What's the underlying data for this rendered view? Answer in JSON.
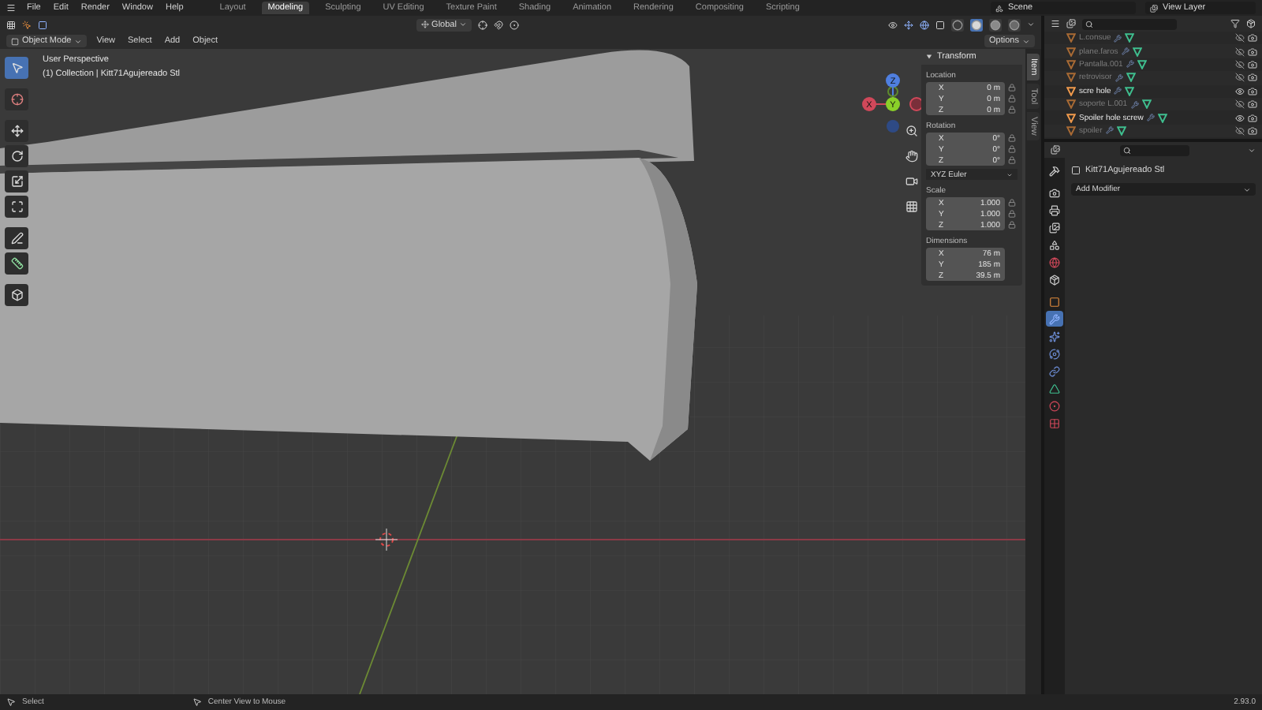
{
  "topbar": {
    "menus": [
      "File",
      "Edit",
      "Render",
      "Window",
      "Help"
    ],
    "workspaces": [
      {
        "label": "Layout",
        "selected": false
      },
      {
        "label": "Modeling",
        "selected": true
      },
      {
        "label": "Sculpting",
        "selected": false
      },
      {
        "label": "UV Editing",
        "selected": false
      },
      {
        "label": "Texture Paint",
        "selected": false
      },
      {
        "label": "Shading",
        "selected": false
      },
      {
        "label": "Animation",
        "selected": false
      },
      {
        "label": "Rendering",
        "selected": false
      },
      {
        "label": "Compositing",
        "selected": false
      },
      {
        "label": "Scripting",
        "selected": false
      }
    ],
    "scene": "Scene",
    "view_layer": "View Layer"
  },
  "viewport": {
    "header": {
      "orientation": "Global",
      "options": "Options",
      "mode": "Object Mode",
      "menus": [
        "View",
        "Select",
        "Add",
        "Object"
      ]
    },
    "shading": [
      {
        "kind": "wireframe",
        "selected": false
      },
      {
        "kind": "solid",
        "selected": true
      },
      {
        "kind": "material",
        "selected": false
      },
      {
        "kind": "rendered",
        "selected": false
      }
    ],
    "overlay_text": {
      "view": "User Perspective",
      "context": "(1) Collection | Kitt71Agujereado Stl"
    },
    "tools": [
      {
        "kind": "select",
        "selected": true
      },
      {
        "kind": "cursor",
        "selected": false
      },
      {
        "kind": "move",
        "selected": false
      },
      {
        "kind": "rotate",
        "selected": false
      },
      {
        "kind": "scale",
        "selected": false
      },
      {
        "kind": "transform",
        "selected": false
      },
      {
        "kind": "annotate",
        "selected": false
      },
      {
        "kind": "measure",
        "selected": false
      },
      {
        "kind": "add_cube",
        "selected": false
      }
    ],
    "gizmo_labels": [
      "Z",
      "X",
      "Y"
    ],
    "sidebar": {
      "tabs": [
        {
          "label": "Item",
          "selected": true
        },
        {
          "label": "Tool",
          "selected": false
        },
        {
          "label": "View",
          "selected": false
        }
      ],
      "panel": {
        "title": "Transform",
        "expanded": true,
        "groups": [
          {
            "label": "Location",
            "fields": [
              {
                "axis": "X",
                "value": "0 m"
              },
              {
                "axis": "Y",
                "value": "0 m"
              },
              {
                "axis": "Z",
                "value": "0 m"
              }
            ]
          },
          {
            "label": "Rotation",
            "fields": [
              {
                "axis": "X",
                "value": "0°"
              },
              {
                "axis": "Y",
                "value": "0°"
              },
              {
                "axis": "Z",
                "value": "0°"
              }
            ],
            "mode": "XYZ Euler"
          },
          {
            "label": "Scale",
            "fields": [
              {
                "axis": "X",
                "value": "1.000"
              },
              {
                "axis": "Y",
                "value": "1.000"
              },
              {
                "axis": "Z",
                "value": "1.000"
              }
            ]
          },
          {
            "label": "Dimensions",
            "fields": [
              {
                "axis": "X",
                "value": "76 m"
              },
              {
                "axis": "Y",
                "value": "185 m"
              },
              {
                "axis": "Z",
                "value": "39.5 m"
              }
            ]
          }
        ]
      }
    }
  },
  "outliner": {
    "rows": [
      {
        "name": "L.consue",
        "visible": false
      },
      {
        "name": "plane.faros",
        "visible": false
      },
      {
        "name": "Pantalla.001",
        "visible": false
      },
      {
        "name": "retrovisor",
        "visible": false
      },
      {
        "name": "scre hole",
        "visible": true
      },
      {
        "name": "soporte L.001",
        "visible": false
      },
      {
        "name": "Spoiler hole screw",
        "visible": true
      },
      {
        "name": "spoiler",
        "visible": false
      }
    ]
  },
  "properties": {
    "tabs": [
      {
        "kind": "tool",
        "selected": false
      },
      {
        "kind": "render",
        "selected": false
      },
      {
        "kind": "output",
        "selected": false
      },
      {
        "kind": "view_layer",
        "selected": false
      },
      {
        "kind": "scene",
        "selected": false
      },
      {
        "kind": "world",
        "selected": false
      },
      {
        "kind": "collection",
        "selected": false
      },
      {
        "kind": "object",
        "selected": false
      },
      {
        "kind": "modifiers",
        "selected": true
      },
      {
        "kind": "particles",
        "selected": false
      },
      {
        "kind": "physics",
        "selected": false
      },
      {
        "kind": "constraints",
        "selected": false
      },
      {
        "kind": "data",
        "selected": false
      },
      {
        "kind": "material",
        "selected": false
      },
      {
        "kind": "texture",
        "selected": false
      }
    ],
    "object_name": "Kitt71Agujereado Stl",
    "add_modifier": "Add Modifier"
  },
  "status_bar": {
    "items": [
      "Select",
      "Center View to Mouse"
    ],
    "version": "2.93.0"
  }
}
